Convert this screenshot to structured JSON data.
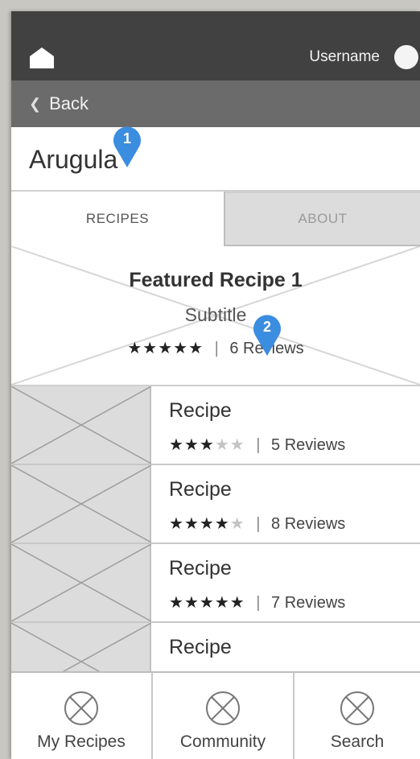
{
  "header": {
    "username": "Username"
  },
  "backbar": {
    "label": "Back"
  },
  "page": {
    "title": "Arugula"
  },
  "tabs": [
    {
      "label": "RECIPES",
      "active": true
    },
    {
      "label": "ABOUT",
      "active": false
    }
  ],
  "featured": {
    "title": "Featured Recipe 1",
    "subtitle": "Subtitle",
    "rating": 5,
    "reviews": "6 Reviews"
  },
  "recipes": [
    {
      "title": "Recipe",
      "rating": 3,
      "reviews": "5 Reviews"
    },
    {
      "title": "Recipe",
      "rating": 4,
      "reviews": "8 Reviews"
    },
    {
      "title": "Recipe",
      "rating": 5,
      "reviews": "7 Reviews"
    },
    {
      "title": "Recipe",
      "rating": null,
      "reviews": ""
    }
  ],
  "bottom_nav": [
    {
      "label": "My Recipes",
      "icon": "placeholder-x-circle-icon"
    },
    {
      "label": "Community",
      "icon": "placeholder-x-circle-icon"
    },
    {
      "label": "Search",
      "icon": "placeholder-x-circle-icon"
    }
  ],
  "annotations": [
    {
      "number": "1",
      "color": "#3b8de0"
    },
    {
      "number": "2",
      "color": "#3b8de0"
    }
  ],
  "colors": {
    "topbar": "#414141",
    "backbar": "#6b6b6b",
    "placeholder": "#dcdcdc",
    "annotation": "#3b8de0"
  }
}
